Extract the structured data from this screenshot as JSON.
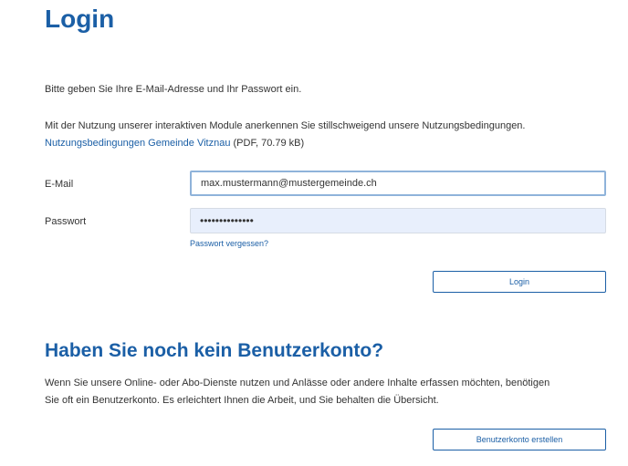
{
  "login": {
    "title": "Login",
    "intro": "Bitte geben Sie Ihre E-Mail-Adresse und Ihr Passwort ein.",
    "terms_text": "Mit der Nutzung unserer interaktiven Module anerkennen Sie stillschweigend unsere Nutzungsbedingungen.",
    "terms_link": "Nutzungsbedingungen Gemeinde Vitznau",
    "terms_file_info": "(PDF, 70.79 kB)",
    "email_label": "E-Mail",
    "email_value": "max.mustermann@mustergemeinde.ch",
    "password_label": "Passwort",
    "password_value": "••••••••••••••",
    "forgot_link": "Passwort vergessen?",
    "submit_label": "Login"
  },
  "register": {
    "title": "Haben Sie noch kein Benutzerkonto?",
    "text_line1": "Wenn Sie unsere Online- oder Abo-Dienste nutzen und Anlässe oder andere Inhalte erfassen möchten, benötigen",
    "text_line2": "Sie oft ein Benutzerkonto. Es erleichtert Ihnen die Arbeit, und Sie behalten die Übersicht.",
    "button_label": "Benutzerkonto erstellen"
  },
  "colors": {
    "accent": "#1b5fa6",
    "text": "#333333",
    "password_bg": "#e8effc",
    "focus_border": "#8fb3da"
  }
}
